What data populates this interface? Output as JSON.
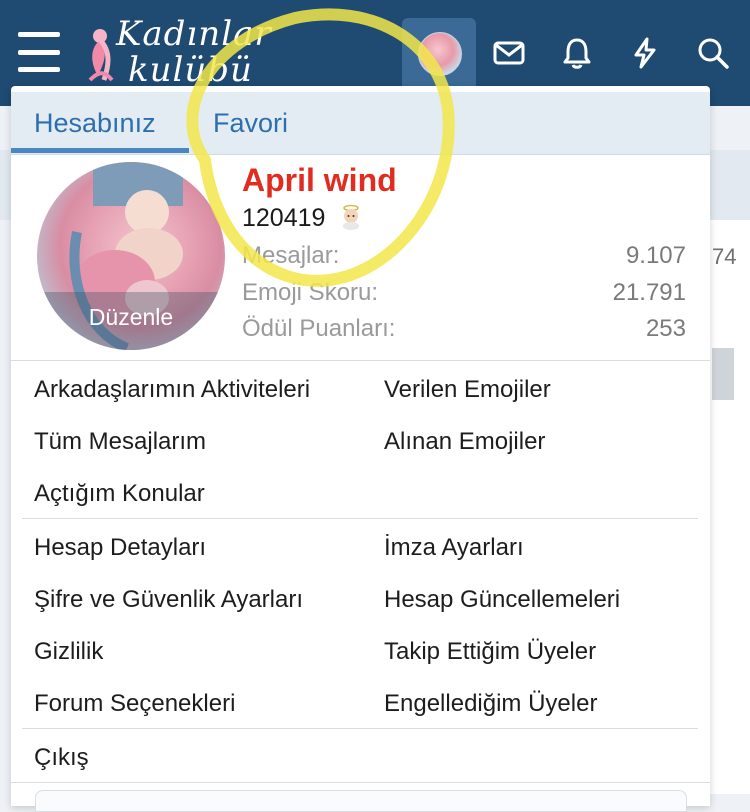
{
  "header": {
    "logo_line1": "Kadınlar",
    "logo_line2": "kulübü"
  },
  "background": {
    "side_number": "74"
  },
  "menu": {
    "tabs": [
      {
        "label": "Hesabınız",
        "active": true
      },
      {
        "label": "Favori",
        "active": false
      }
    ],
    "profile": {
      "username": "April wind",
      "user_title": "120419",
      "edit_label": "Düzenle",
      "stats": [
        {
          "label": "Mesajlar:",
          "value": "9.107"
        },
        {
          "label": "Emoji Skoru:",
          "value": "21.791"
        },
        {
          "label": "Ödül Puanları:",
          "value": "253"
        }
      ]
    },
    "section1": {
      "left": [
        "Arkadaşlarımın Aktiviteleri",
        "Tüm Mesajlarım",
        "Açtığım Konular"
      ],
      "right": [
        "Verilen Emojiler",
        "Alınan Emojiler"
      ]
    },
    "section2": {
      "left": [
        "Hesap Detayları",
        "Şifre ve Güvenlik Ayarları",
        "Gizlilik",
        "Forum Seçenekleri"
      ],
      "right": [
        "İmza Ayarları",
        "Hesap Güncellemeleri",
        "Takip Ettiğim Üyeler",
        "Engellediğim Üyeler"
      ]
    },
    "logout_label": "Çıkış"
  },
  "colors": {
    "header_bg": "#1f4a72",
    "tab_text": "#2d6fae",
    "username": "#e12c1f",
    "annotation": "#f2e64a"
  },
  "icons": [
    "menu-icon",
    "envelope-icon",
    "bell-icon",
    "lightning-icon",
    "search-icon"
  ]
}
